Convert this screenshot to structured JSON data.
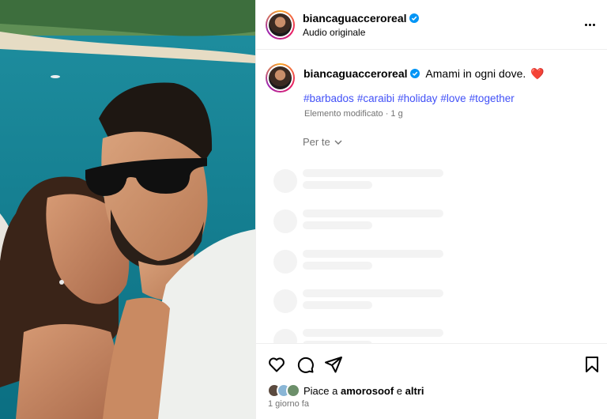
{
  "post": {
    "username": "biancaguacceroreal",
    "audio_label": "Audio originale",
    "more_icon": "more-horizontal-icon"
  },
  "caption": {
    "username": "biancaguacceroreal",
    "text": "Amami in ogni dove.",
    "emoji": "❤️",
    "hashtags": [
      "#barbados",
      "#caraibi",
      "#holiday",
      "#love",
      "#together"
    ],
    "meta": "Elemento modificato · 1 g"
  },
  "comments_filter": {
    "label": "Per te",
    "icon": "chevron-down-icon"
  },
  "actions": {
    "icons": [
      "heart-icon",
      "comment-icon",
      "share-icon",
      "bookmark-icon"
    ],
    "likes_prefix": "Piace a",
    "likes_user": "amorosoof",
    "likes_join": "e",
    "likes_others": "altri",
    "time": "1 giorno fa"
  },
  "colors": {
    "hashtag": "#4150f7",
    "verified": "#0095f6",
    "muted": "#737373"
  }
}
